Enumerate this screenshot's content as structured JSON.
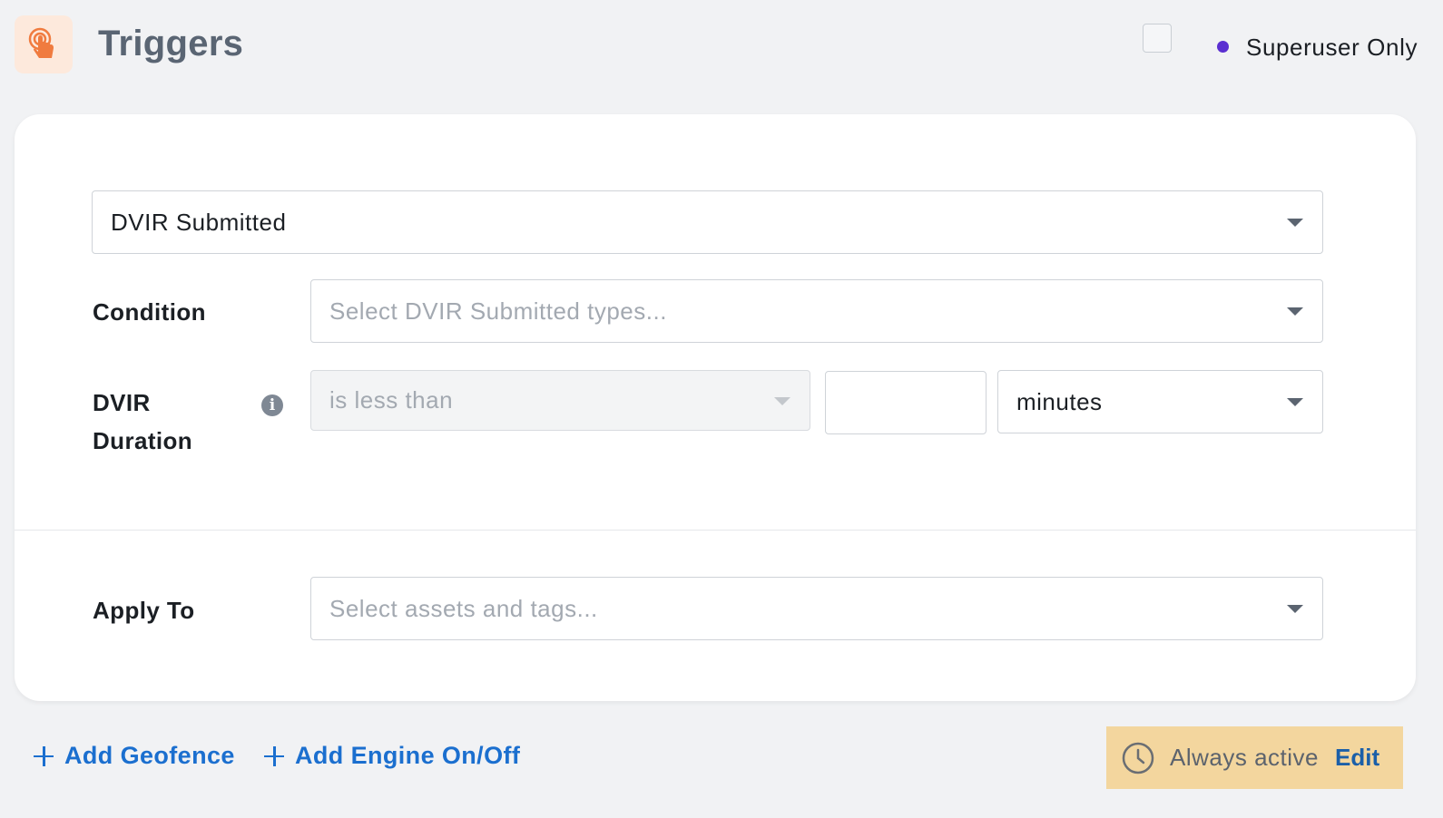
{
  "header": {
    "title": "Triggers",
    "icon": "tap-hand-icon",
    "superuser_label": "Superuser Only",
    "superuser_checked": false,
    "superuser_dot_color": "#5b2fd1"
  },
  "trigger": {
    "type_value": "DVIR Submitted",
    "condition_label": "Condition",
    "condition_placeholder": "Select DVIR Submitted types...",
    "duration_label_line1": "DVIR",
    "duration_label_line2": "Duration",
    "duration_operator": "is less than",
    "duration_value": "",
    "duration_unit": "minutes"
  },
  "apply_to": {
    "label": "Apply To",
    "placeholder": "Select assets and tags..."
  },
  "footer": {
    "add_geofence": "Add Geofence",
    "add_engine": "Add Engine On/Off",
    "schedule_text": "Always active",
    "edit_label": "Edit"
  },
  "colors": {
    "accent": "#1b6fcf",
    "schedule_bg": "#f3d69e",
    "icon_bg": "#fde9dc",
    "icon_fg": "#f07b3f"
  }
}
